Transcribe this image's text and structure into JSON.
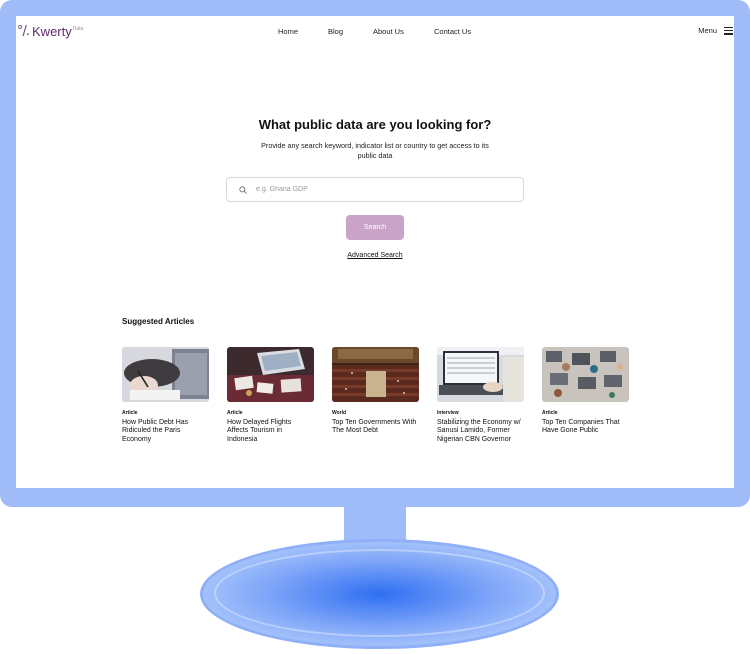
{
  "brand": {
    "mark": "°/.",
    "name": "Kwerty",
    "sup": "Data"
  },
  "nav": {
    "links": [
      "Home",
      "Blog",
      "About Us",
      "Contact Us"
    ],
    "menu_label": "Menu"
  },
  "hero": {
    "title": "What public data are you looking for?",
    "subtitle": "Provide any search keyword, indicator list or country to get access to its public data"
  },
  "search": {
    "placeholder": "e.g. Ghana GDP",
    "value": "",
    "button_label": "Search",
    "advanced_label": "Advanced Search",
    "button_color": "#c9a3c8"
  },
  "articles": {
    "heading": "Suggested Articles",
    "items": [
      {
        "category": "Article",
        "title": "How Public Debt Has Ridiculed the Paris Economy",
        "image": "person-writing-laptop"
      },
      {
        "category": "Article",
        "title": "How Delayed Flights Affects Tourism in Indonesia",
        "image": "desk-documents-laptop"
      },
      {
        "category": "World",
        "title": "Top Ten Governments With The Most Debt",
        "image": "parliament-chamber"
      },
      {
        "category": "Interview",
        "title": "Stabilizing the Economy w/ Sanusi Lamido, Former Nigerian CBN Governor",
        "image": "laptop-spreadsheet"
      },
      {
        "category": "Article",
        "title": "Top Ten Companies That Have Gone Public",
        "image": "team-desk-overhead"
      }
    ]
  },
  "colors": {
    "brand": "#5d2b6e",
    "monitor_frame": "#9fbcf9",
    "accent": "#c9a3c8"
  }
}
